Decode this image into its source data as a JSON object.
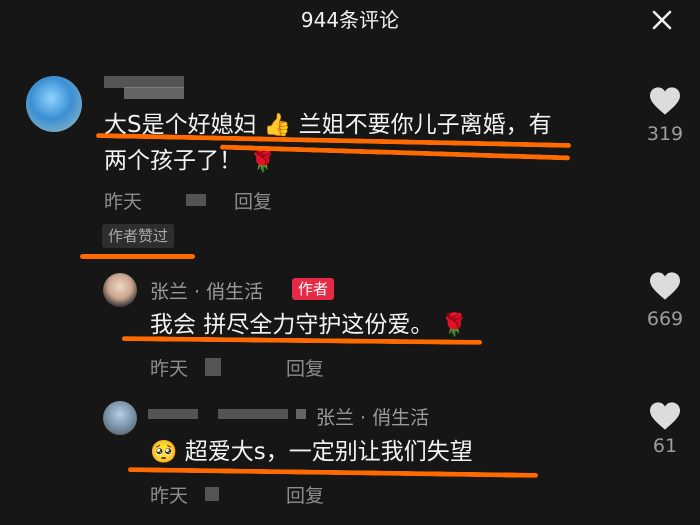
{
  "header": {
    "title": "944条评论",
    "close_icon": "close-icon"
  },
  "comments": [
    {
      "text_line1": "大S是个好媳妇",
      "text_line1b": "兰姐不要你儿子离婚，有",
      "text_line2": "两个孩子了！",
      "time": "昨天",
      "reply": "回复",
      "badge": "作者赞过",
      "likes": "319"
    },
    {
      "name": "张兰 · 俏生活",
      "author_tag": "作者",
      "text_a": "我会",
      "text_b": "拼尽全力守护这份爱。",
      "time": "昨天",
      "reply": "回复",
      "likes": "669"
    },
    {
      "reply_to": "张兰 · 俏生活",
      "text": "超爱大s，一定别让我们失望",
      "time": "昨天",
      "reply": "回复",
      "likes": "61"
    }
  ],
  "colors": {
    "accent_underline": "#ff6a00",
    "author_tag": "#e62a45",
    "background": "#161616"
  }
}
